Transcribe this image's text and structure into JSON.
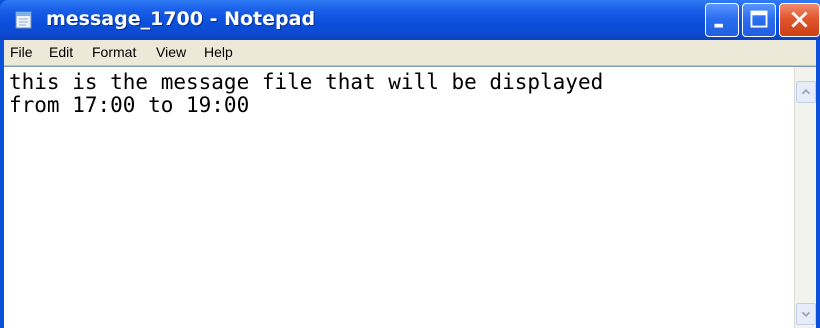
{
  "window": {
    "title": "message_1700 - Notepad",
    "app_icon": "notepad-icon",
    "controls": {
      "minimize_icon": "minimize-icon",
      "maximize_icon": "maximize-icon",
      "close_icon": "close-icon"
    },
    "colors": {
      "titlebar": "#0b4fdc",
      "close_button": "#e2572e",
      "menubar": "#ece9d8"
    }
  },
  "menubar": {
    "items": [
      {
        "label": "File"
      },
      {
        "label": "Edit"
      },
      {
        "label": "Format"
      },
      {
        "label": "View"
      },
      {
        "label": "Help"
      }
    ]
  },
  "editor": {
    "text": "this is the message file that will be displayed\nfrom 17:00 to 19:00"
  },
  "scrollbar": {
    "up_icon": "scroll-up-arrow-icon",
    "down_icon": "scroll-down-arrow-icon"
  }
}
